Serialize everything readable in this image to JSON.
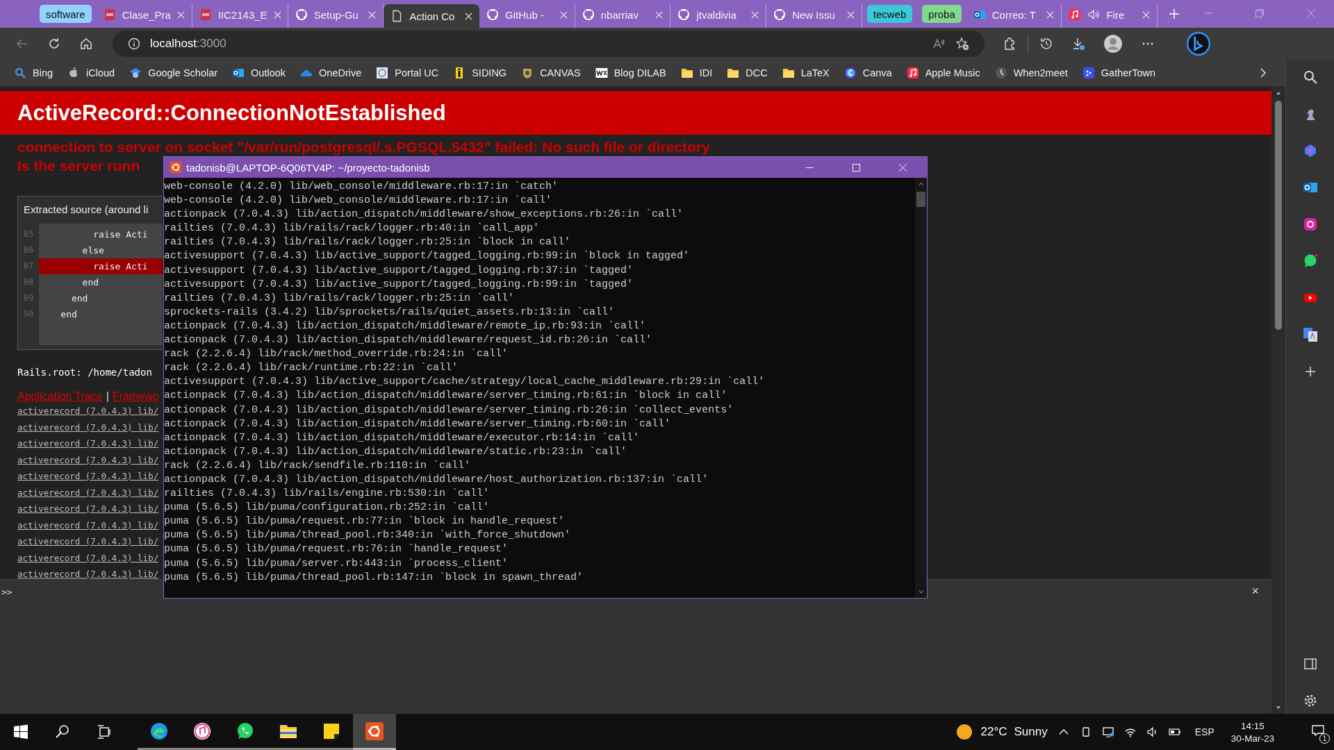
{
  "browser": {
    "tabs": [
      {
        "kind": "group",
        "label": "software",
        "color": "#8fd3fe"
      },
      {
        "kind": "pdf",
        "label": "Clase_Pra",
        "selected": false
      },
      {
        "kind": "pdf",
        "label": "IIC2143_E",
        "selected": false
      },
      {
        "kind": "github",
        "label": "Setup-Gu",
        "selected": false
      },
      {
        "kind": "page",
        "label": "Action Co",
        "selected": true
      },
      {
        "kind": "github",
        "label": "GitHub -",
        "selected": false
      },
      {
        "kind": "github",
        "label": "nbarriav",
        "selected": false
      },
      {
        "kind": "github",
        "label": "jtvaldivia",
        "selected": false
      },
      {
        "kind": "github",
        "label": "New Issu",
        "selected": false
      },
      {
        "kind": "group",
        "label": "tecweb",
        "color": "#3cc8d8"
      },
      {
        "kind": "group",
        "label": "proba",
        "color": "#80d98c"
      },
      {
        "kind": "outlook",
        "label": "Correo: T",
        "selected": false
      },
      {
        "kind": "music",
        "label": "Fire",
        "selected": false
      }
    ],
    "address": {
      "host": "localhost",
      "port": ":3000"
    },
    "bookmarks": [
      {
        "kind": "search",
        "label": "Bing"
      },
      {
        "kind": "apple",
        "label": "iCloud"
      },
      {
        "kind": "scholar",
        "label": "Google Scholar"
      },
      {
        "kind": "outlook",
        "label": "Outlook"
      },
      {
        "kind": "cloud",
        "label": "OneDrive"
      },
      {
        "kind": "crest",
        "label": "Portal UC"
      },
      {
        "kind": "siding",
        "label": "SIDING"
      },
      {
        "kind": "canvas",
        "label": "CANVAS"
      },
      {
        "kind": "wix",
        "label": "Blog DILAB"
      },
      {
        "kind": "folder",
        "label": "IDI"
      },
      {
        "kind": "folder",
        "label": "DCC"
      },
      {
        "kind": "folder",
        "label": "LaTeX"
      },
      {
        "kind": "canva",
        "label": "Canva"
      },
      {
        "kind": "music",
        "label": "Apple Music"
      },
      {
        "kind": "clock",
        "label": "When2meet"
      },
      {
        "kind": "gather",
        "label": "GatherTown"
      }
    ]
  },
  "page": {
    "title": "ActiveRecord::ConnectionNotEstablished",
    "messages": [
      "connection to server on socket \"/var/run/postgresql/.s.PGSQL.5432\" failed: No such file or directory",
      "Is the server runn"
    ],
    "source": {
      "heading": "Extracted source (around li",
      "lines": [
        {
          "number": "85",
          "code": "          raise Acti",
          "highlighted": false
        },
        {
          "number": "86",
          "code": "        else",
          "highlighted": false
        },
        {
          "number": "87",
          "code": "          raise Acti",
          "highlighted": true
        },
        {
          "number": "88",
          "code": "        end",
          "highlighted": false
        },
        {
          "number": "89",
          "code": "      end",
          "highlighted": false
        },
        {
          "number": "90",
          "code": "    end",
          "highlighted": false
        }
      ]
    },
    "rails_root": "Rails.root: /home/tadon",
    "trace_links": [
      "Application Trace",
      "Framewo"
    ],
    "trace_separator": "|",
    "trace_lines": [
      "activerecord (7.0.4.3) lib/",
      "activerecord (7.0.4.3) lib/",
      "activerecord (7.0.4.3) lib/",
      "activerecord (7.0.4.3) lib/",
      "activerecord (7.0.4.3) lib/",
      "activerecord (7.0.4.3) lib/",
      "activerecord (7.0.4.3) lib/",
      "activerecord (7.0.4.3) lib/",
      "activerecord (7.0.4.3) lib/",
      "activerecord (7.0.4.3) lib/",
      "activerecord (7.0.4.3) lib/"
    ]
  },
  "console": {
    "prompt": ">>",
    "close": "×"
  },
  "terminal": {
    "title": "tadonisb@LAPTOP-6Q06TV4P: ~/proyecto-tadonisb",
    "lines": [
      "web-console (4.2.0) lib/web_console/middleware.rb:17:in `catch'",
      "web-console (4.2.0) lib/web_console/middleware.rb:17:in `call'",
      "actionpack (7.0.4.3) lib/action_dispatch/middleware/show_exceptions.rb:26:in `call'",
      "railties (7.0.4.3) lib/rails/rack/logger.rb:40:in `call_app'",
      "railties (7.0.4.3) lib/rails/rack/logger.rb:25:in `block in call'",
      "activesupport (7.0.4.3) lib/active_support/tagged_logging.rb:99:in `block in tagged'",
      "activesupport (7.0.4.3) lib/active_support/tagged_logging.rb:37:in `tagged'",
      "activesupport (7.0.4.3) lib/active_support/tagged_logging.rb:99:in `tagged'",
      "railties (7.0.4.3) lib/rails/rack/logger.rb:25:in `call'",
      "sprockets-rails (3.4.2) lib/sprockets/rails/quiet_assets.rb:13:in `call'",
      "actionpack (7.0.4.3) lib/action_dispatch/middleware/remote_ip.rb:93:in `call'",
      "actionpack (7.0.4.3) lib/action_dispatch/middleware/request_id.rb:26:in `call'",
      "rack (2.2.6.4) lib/rack/method_override.rb:24:in `call'",
      "rack (2.2.6.4) lib/rack/runtime.rb:22:in `call'",
      "activesupport (7.0.4.3) lib/active_support/cache/strategy/local_cache_middleware.rb:29:in `call'",
      "actionpack (7.0.4.3) lib/action_dispatch/middleware/server_timing.rb:61:in `block in call'",
      "actionpack (7.0.4.3) lib/action_dispatch/middleware/server_timing.rb:26:in `collect_events'",
      "actionpack (7.0.4.3) lib/action_dispatch/middleware/server_timing.rb:60:in `call'",
      "actionpack (7.0.4.3) lib/action_dispatch/middleware/executor.rb:14:in `call'",
      "actionpack (7.0.4.3) lib/action_dispatch/middleware/static.rb:23:in `call'",
      "rack (2.2.6.4) lib/rack/sendfile.rb:110:in `call'",
      "actionpack (7.0.4.3) lib/action_dispatch/middleware/host_authorization.rb:137:in `call'",
      "railties (7.0.4.3) lib/rails/engine.rb:530:in `call'",
      "puma (5.6.5) lib/puma/configuration.rb:252:in `call'",
      "puma (5.6.5) lib/puma/request.rb:77:in `block in handle_request'",
      "puma (5.6.5) lib/puma/thread_pool.rb:340:in `with_force_shutdown'",
      "puma (5.6.5) lib/puma/request.rb:76:in `handle_request'",
      "puma (5.6.5) lib/puma/server.rb:443:in `process_client'",
      "puma (5.6.5) lib/puma/thread_pool.rb:147:in `block in spawn_thread'"
    ]
  },
  "taskbar": {
    "apps": [
      {
        "kind": "edge",
        "selected": false
      },
      {
        "kind": "music",
        "selected": false
      },
      {
        "kind": "whatsapp",
        "selected": false
      },
      {
        "kind": "folder",
        "selected": false
      },
      {
        "kind": "notes",
        "selected": false
      },
      {
        "kind": "ubuntu",
        "selected": true
      }
    ],
    "weather": {
      "temperature": "22°C",
      "condition": "Sunny"
    },
    "language": "ESP",
    "time": "14:15",
    "date": "30-Mar-23",
    "notifications": "1"
  }
}
